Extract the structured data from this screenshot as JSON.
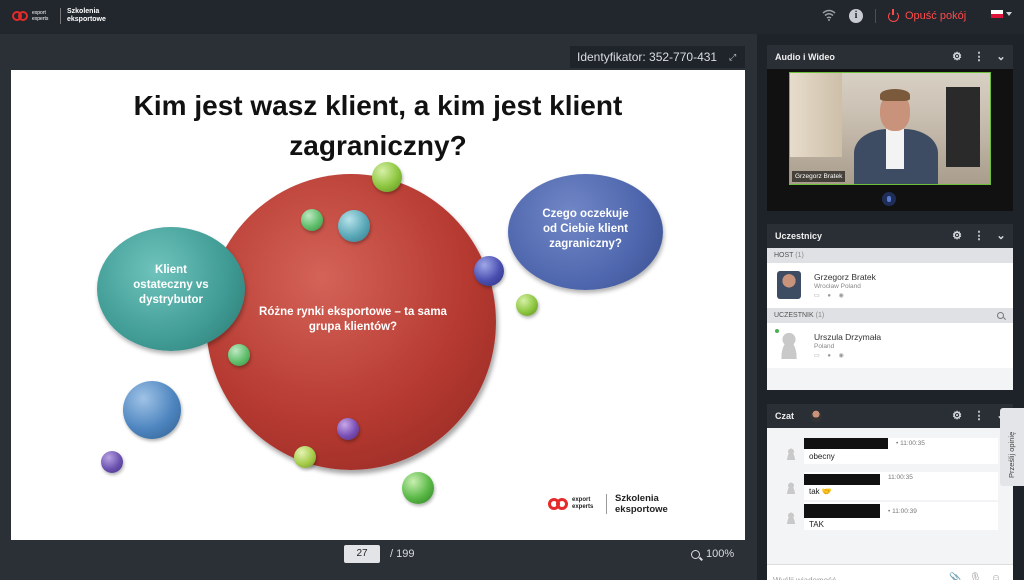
{
  "topbar": {
    "logo_small": "export experts",
    "logo_text": "Szkolenia eksportowe",
    "leave_label": "Opuść pokój"
  },
  "presentation": {
    "identifier": "Identyfikator: 352-770-431",
    "slide": {
      "title": "Kim jest wasz klient, a kim jest klient zagraniczny?",
      "center_text": "Różne rynki eksportowe – ta sama grupa klientów?",
      "left_text": "Klient ostateczny vs dystrybutor",
      "right_text": "Czego oczekuje od Ciebie klient zagraniczny?",
      "logo_small": "export experts",
      "logo_text": "Szkolenia eksportowe"
    },
    "page_current": "27",
    "page_total": "/ 199",
    "zoom": "100%"
  },
  "audio_video": {
    "title": "Audio i Wideo",
    "video_name": "Grzegorz Bratek"
  },
  "participants": {
    "title": "Uczestnicy",
    "host_label": "HOST",
    "host_count": "(1)",
    "host": {
      "name": "Grzegorz Bratek",
      "location": "Wrocław Poland"
    },
    "participant_label": "UCZESTNIK",
    "participant_count": "(1)",
    "participant": {
      "name": "Urszula Drzymała",
      "location": "Poland"
    }
  },
  "chat": {
    "title": "Czat",
    "messages": [
      {
        "time": "• 11:00:35",
        "text": "obecny"
      },
      {
        "time": "11:00:35",
        "text": "tak 🤝"
      },
      {
        "time": "• 11:00:39",
        "text": "TAK"
      }
    ],
    "input_placeholder": "Wyślij wiadomość..."
  },
  "feedback": {
    "label": "Prześlij opinię"
  }
}
